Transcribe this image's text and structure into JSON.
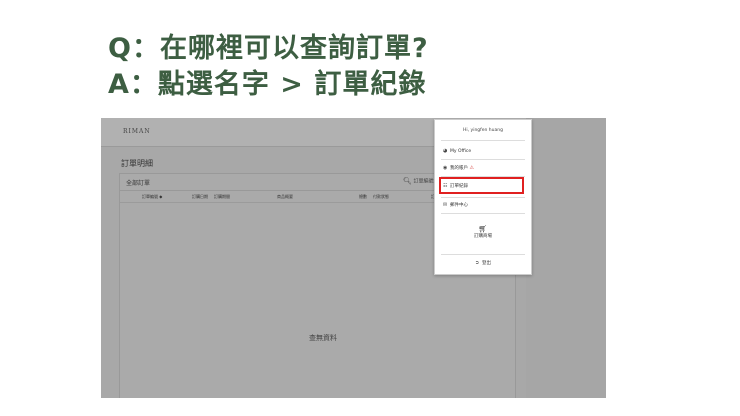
{
  "qa": {
    "question": "Q：在哪裡可以查詢訂單?",
    "answer": "A：點選名字 > 訂單紀錄"
  },
  "app": {
    "brand": "RIMAN",
    "page_title": "訂單明細",
    "tab_all": "全部訂單",
    "search_placeholder": "訂單編號、",
    "columns": [
      "訂單編號 ◆",
      "訂購日期",
      "訂購期間",
      "商品概要",
      "總數",
      "付款狀態",
      "訂"
    ],
    "empty_text": "查無資料"
  },
  "dropdown": {
    "greeting": "Hi, yingfen huang",
    "items": [
      {
        "icon": "pie-chart-icon",
        "label": "My Office"
      },
      {
        "icon": "user-circle-icon",
        "label": "我的帳戶"
      },
      {
        "icon": "sitemap-icon",
        "label": "訂單紀錄"
      },
      {
        "icon": "envelope-icon",
        "label": "郵件中心"
      }
    ],
    "cart_label": "訂購商場",
    "logout_label": "登出"
  },
  "colors": {
    "heading": "#3d5e42",
    "highlight": "#e02020"
  }
}
